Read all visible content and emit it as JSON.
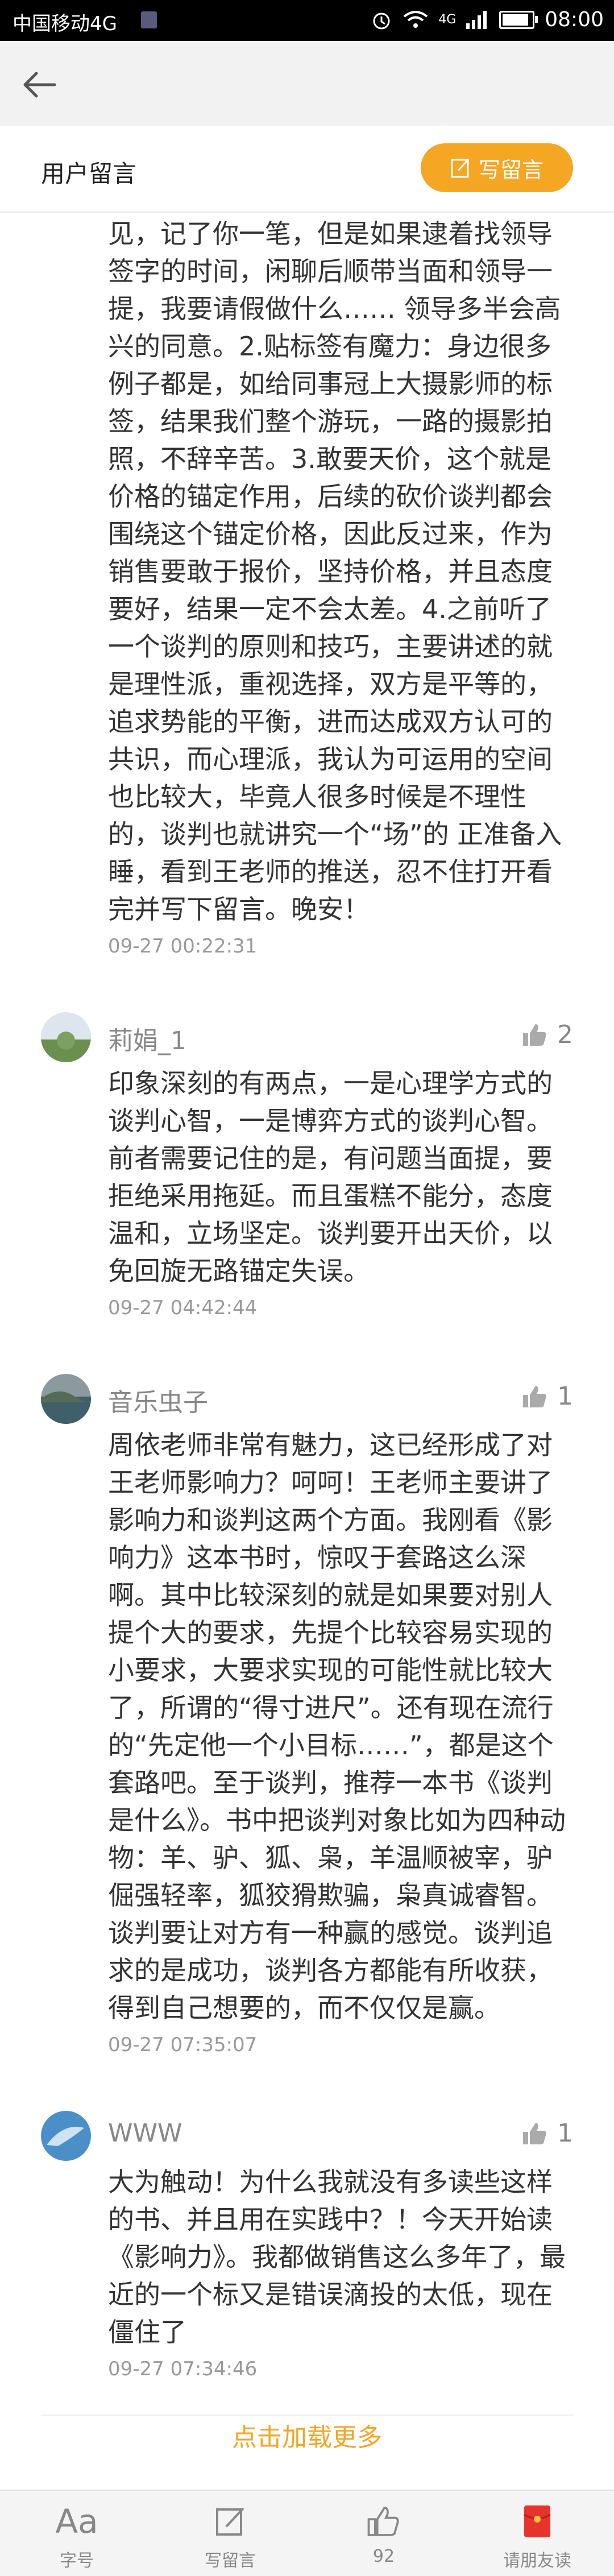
{
  "status_bar": {
    "carrier": "中国移动4G",
    "signal": "4G",
    "time": "08:00",
    "battery_level": 0.9
  },
  "header": {
    "title": "用户留言",
    "write_label": "写留言"
  },
  "comments": [
    {
      "text": "见，记了你一笔，但是如果逮着找领导签字的时间，闲聊后顺带当面和领导一提，我要请假做什么…… 领导多半会高兴的同意。2.贴标签有魔力：身边很多例子都是，如给同事冠上大摄影师的标签，结果我们整个游玩，一路的摄影拍照，不辞辛苦。3.敢要天价，这个就是价格的锚定作用，后续的砍价谈判都会围绕这个锚定价格，因此反过来，作为销售要敢于报价，坚持价格，并且态度要好，结果一定不会太差。4.之前听了一个谈判的原则和技巧，主要讲述的就是理性派，重视选择，双方是平等的，追求势能的平衡，进而达成双方认可的共识，而心理派，我认为可运用的空间也比较大，毕竟人很多时候是不理性的，谈判也就讲究一个“场”的 正准备入睡，看到王老师的推送，忍不住打开看完并写下留言。晚安！",
      "time": "09-27 00:22:31"
    },
    {
      "username": "莉娟_1",
      "likes": "2",
      "text": "印象深刻的有两点，一是心理学方式的谈判心智，一是博弈方式的谈判心智。前者需要记住的是，有问题当面提，要拒绝采用拖延。而且蛋糕不能分，态度温和，立场坚定。谈判要开出天价，以免回旋无路锚定失误。",
      "time": "09-27 04:42:44"
    },
    {
      "username": "音乐虫子",
      "likes": "1",
      "text": "周依老师非常有魅力，这已经形成了对王老师影响力？呵呵！王老师主要讲了影响力和谈判这两个方面。我刚看《影响力》这本书时，惊叹于套路这么深啊。其中比较深刻的就是如果要对别人提个大的要求，先提个比较容易实现的小要求，大要求实现的可能性就比较大了，所谓的“得寸进尺”。还有现在流行的“先定他一个小目标……”，都是这个套路吧。至于谈判，推荐一本书《谈判是什么》。书中把谈判对象比如为四种动物：羊、驴、狐、枭，羊温顺被宰，驴倔强轻率，狐狡猾欺骗，枭真诚睿智。谈判要让对方有一种赢的感觉。谈判追求的是成功，谈判各方都能有所收获，得到自己想要的，而不仅仅是赢。",
      "time": "09-27 07:35:07"
    },
    {
      "username": "WWW",
      "likes": "1",
      "text": "大为触动！为什么我就没有多读些这样的书、并且用在实践中？！今天开始读《影响力》。我都做销售这么多年了，最近的一个标又是错误滴投的太低，现在僵住了",
      "time": "09-27 07:34:46"
    }
  ],
  "load_more": "点击加载更多",
  "bottom_bar": {
    "font_size_label": "字号",
    "write_label": "写留言",
    "like_count": "92",
    "invite_label": "请朋友读"
  },
  "colors": {
    "accent": "#f5a623",
    "invite_red": "#e8332a"
  }
}
